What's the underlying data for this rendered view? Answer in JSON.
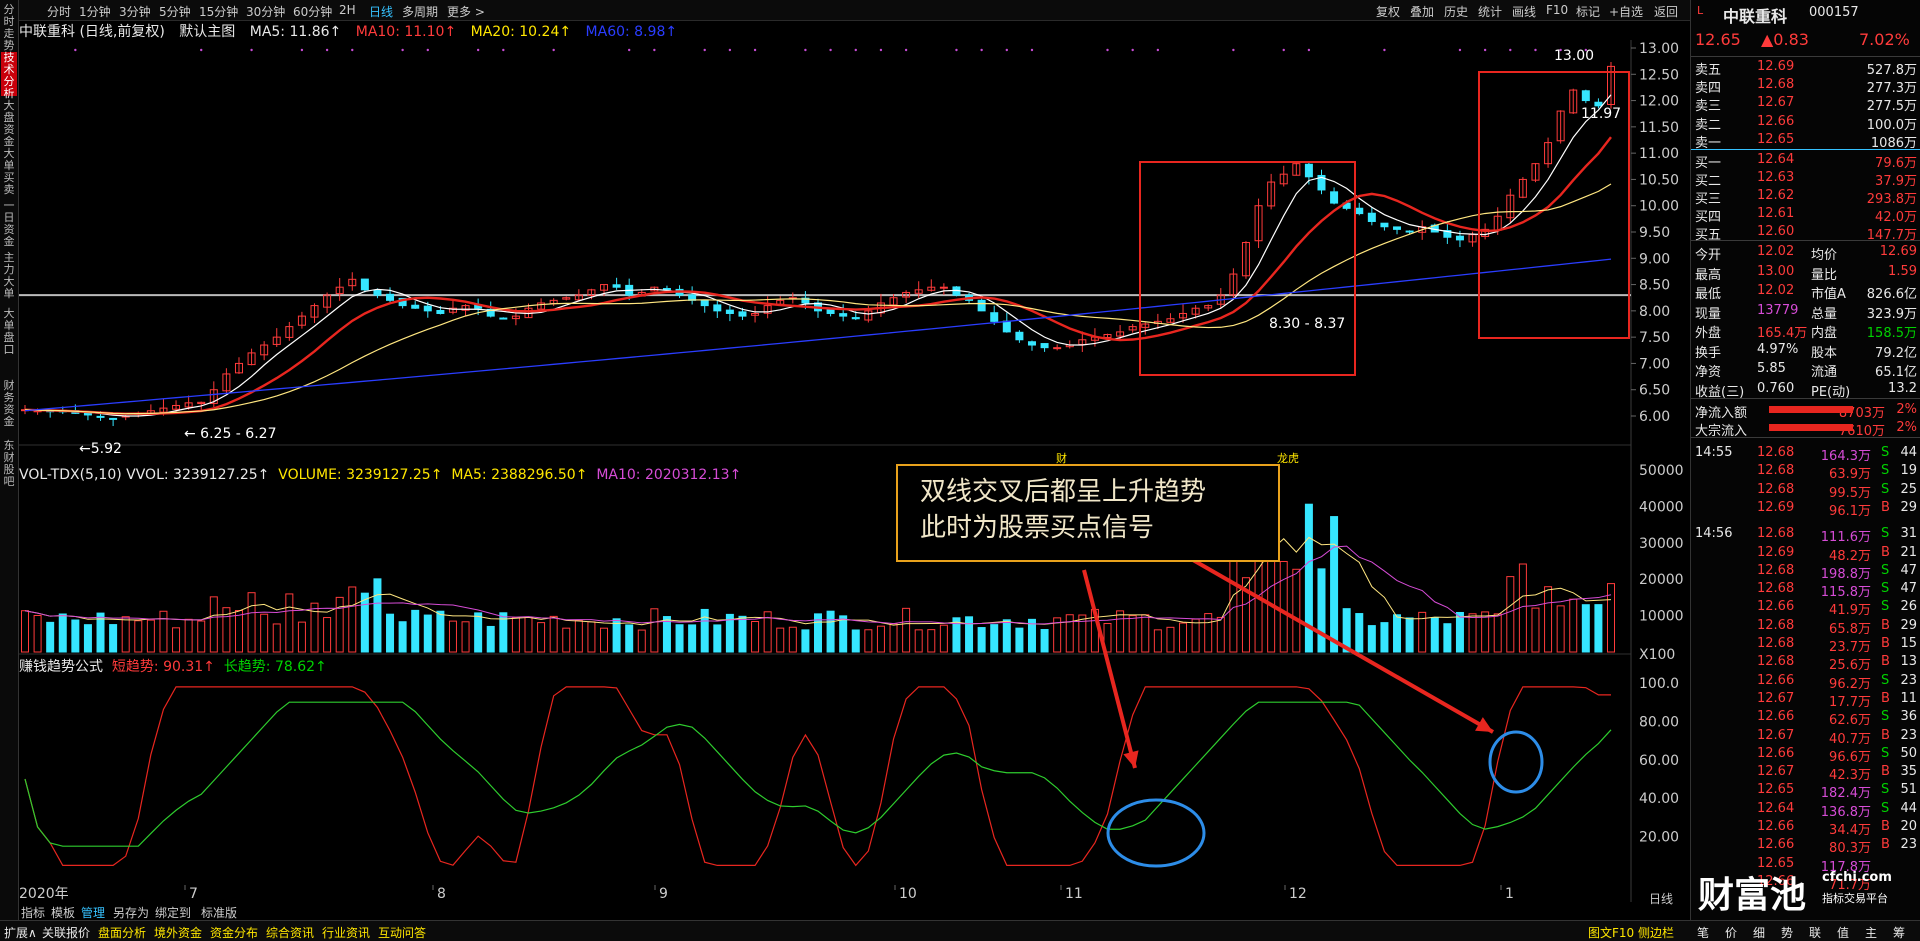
{
  "left_tabs": [
    {
      "label": "分时走势"
    },
    {
      "label": "技术分析"
    },
    {
      "label": "大盘资金"
    },
    {
      "label": "大单买卖"
    },
    {
      "label": "一日资金"
    },
    {
      "label": "主力大单"
    },
    {
      "label": "大单盘口"
    },
    {
      "label": "财务资金"
    },
    {
      "label": "东财股吧"
    }
  ],
  "timeframes": [
    "分时",
    "1分钟",
    "3分钟",
    "5分钟",
    "15分钟",
    "30分钟",
    "60分钟",
    "2H",
    "日线",
    "多周期",
    "更多 >"
  ],
  "toolbar_right": [
    "复权",
    "叠加",
    "历史",
    "统计",
    "画线",
    "F10",
    "标记",
    "+自选",
    "返回"
  ],
  "title": {
    "stock": "中联重科 (日线,前复权)",
    "main": "默认主图",
    "ma5": "MA5: 11.86↑",
    "ma10": "MA10: 11.10↑",
    "ma20": "MA20: 10.24↑",
    "ma60": "MA60: 8.98↑"
  },
  "vol_title": {
    "label": "VOL-TDX(5,10) VVOL: 3239127.25↑",
    "volume": "VOLUME: 3239127.25↑",
    "ma5": "MA5: 2388296.50↑",
    "ma10": "MA10: 2020312.13↑"
  },
  "ind_title": {
    "label": "赚钱趋势公式",
    "short": "短趋势: 90.31↑",
    "long": "长趋势: 78.62↑"
  },
  "price_axis": [
    "13.00",
    "12.50",
    "12.00",
    "11.50",
    "11.00",
    "10.50",
    "10.00",
    "9.50",
    "9.00",
    "8.50",
    "8.00",
    "7.50",
    "7.00",
    "6.50",
    "6.00"
  ],
  "vol_axis": [
    "50000",
    "40000",
    "30000",
    "20000",
    "10000",
    "X100"
  ],
  "ind_axis": [
    "100.0",
    "80.00",
    "60.00",
    "40.00",
    "20.00"
  ],
  "x_labels": [
    "2020年",
    "7",
    "8",
    "9",
    "10",
    "11",
    "12",
    "1"
  ],
  "annotations": {
    "low_label": "5.92",
    "range1": "6.25 - 6.27",
    "range2": "8.30 - 8.37",
    "high_label": "13.00",
    "last_label": "11.97",
    "callout_line1": "双线交叉后都呈上升趋势",
    "callout_line2": "此时为股票买点信号",
    "cai": "财",
    "longhu": "龙虎"
  },
  "chart_data": {
    "type": "candlestick",
    "title": "中联重科 (日线,前复权)",
    "ylim": [
      6.0,
      13.0
    ],
    "x_ticks": [
      "2020年",
      "7",
      "8",
      "9",
      "10",
      "11",
      "12",
      "1"
    ],
    "ohlc_summary": {
      "low": 5.92,
      "high": 13.0,
      "last_close": 12.65
    },
    "ma": {
      "MA5": 11.86,
      "MA10": 11.1,
      "MA20": 10.24,
      "MA60": 8.98
    },
    "volume": {
      "VVOL": 3239127.25,
      "MA5": 2388296.5,
      "MA10": 2020312.13,
      "ylim": [
        0,
        50000
      ]
    },
    "indicator": {
      "short_trend": 90.31,
      "long_trend": 78.62,
      "ylim": [
        0,
        100
      ]
    },
    "closes": [
      6.12,
      6.1,
      6.1,
      6.08,
      6.05,
      6.02,
      5.98,
      5.95,
      6.0,
      6.05,
      6.1,
      6.15,
      6.2,
      6.25,
      6.26,
      6.5,
      6.8,
      7.0,
      7.2,
      7.35,
      7.5,
      7.7,
      7.9,
      8.1,
      8.3,
      8.45,
      8.6,
      8.4,
      8.3,
      8.2,
      8.1,
      8.05,
      8.0,
      7.95,
      8.05,
      8.1,
      8.05,
      7.9,
      7.85,
      7.9,
      8.05,
      8.15,
      8.2,
      8.25,
      8.3,
      8.4,
      8.5,
      8.45,
      8.3,
      8.35,
      8.45,
      8.4,
      8.3,
      8.2,
      8.1,
      8.0,
      7.95,
      7.9,
      7.95,
      8.1,
      8.2,
      8.25,
      8.15,
      8.0,
      7.95,
      7.9,
      7.85,
      8.0,
      8.15,
      8.25,
      8.35,
      8.4,
      8.45,
      8.45,
      8.3,
      8.2,
      8.0,
      7.8,
      7.6,
      7.45,
      7.35,
      7.3,
      7.3,
      7.35,
      7.45,
      7.5,
      7.55,
      7.6,
      7.7,
      7.75,
      7.8,
      7.85,
      7.95,
      8.05,
      8.1,
      8.3,
      8.7,
      9.3,
      10.0,
      10.45,
      10.6,
      10.8,
      10.55,
      10.3,
      10.05,
      9.95,
      9.85,
      9.7,
      9.6,
      9.55,
      9.5,
      9.6,
      9.5,
      9.4,
      9.35,
      9.45,
      9.55,
      9.8,
      10.2,
      10.5,
      10.8,
      11.2,
      11.8,
      12.2,
      12.0,
      11.9,
      12.65
    ]
  },
  "right": {
    "name": "中联重科",
    "code": "000157",
    "price": "12.65",
    "change": "▲0.83",
    "pct": "7.02%",
    "sell": [
      {
        "label": "卖五",
        "price": "12.69",
        "vol": "527.8万"
      },
      {
        "label": "卖四",
        "price": "12.68",
        "vol": "277.3万"
      },
      {
        "label": "卖三",
        "price": "12.67",
        "vol": "277.5万"
      },
      {
        "label": "卖二",
        "price": "12.66",
        "vol": "100.0万"
      },
      {
        "label": "卖一",
        "price": "12.65",
        "vol": "1086万"
      }
    ],
    "buy": [
      {
        "label": "买一",
        "price": "12.64",
        "vol": "79.6万"
      },
      {
        "label": "买二",
        "price": "12.63",
        "vol": "37.9万"
      },
      {
        "label": "买三",
        "price": "12.62",
        "vol": "293.8万"
      },
      {
        "label": "买四",
        "price": "12.61",
        "vol": "42.0万"
      },
      {
        "label": "买五",
        "price": "12.60",
        "vol": "147.7万"
      }
    ],
    "stats": [
      {
        "k1": "今开",
        "v1": "12.02",
        "k2": "均价",
        "v2": "12.69",
        "c1": "red",
        "c2": "red"
      },
      {
        "k1": "最高",
        "v1": "13.00",
        "k2": "量比",
        "v2": "1.59",
        "c1": "red",
        "c2": "red"
      },
      {
        "k1": "最低",
        "v1": "12.02",
        "k2": "市值A",
        "v2": "826.6亿",
        "c1": "red",
        "c2": "wht"
      },
      {
        "k1": "现量",
        "v1": "13779",
        "k2": "总量",
        "v2": "323.9万",
        "c1": "mag",
        "c2": "wht"
      },
      {
        "k1": "外盘",
        "v1": "165.4万",
        "k2": "内盘",
        "v2": "158.5万",
        "c1": "red",
        "c2": "grn"
      },
      {
        "k1": "换手",
        "v1": "4.97%",
        "k2": "股本",
        "v2": "79.2亿",
        "c1": "wht",
        "c2": "wht"
      },
      {
        "k1": "净资",
        "v1": "5.85",
        "k2": "流通",
        "v2": "65.1亿",
        "c1": "wht",
        "c2": "wht"
      },
      {
        "k1": "收益(三)",
        "v1": "0.760",
        "k2": "PE(动)",
        "v2": "13.2",
        "c1": "wht",
        "c2": "wht"
      }
    ],
    "flow": [
      {
        "label": "净流入额",
        "value": "8703万",
        "pct": "2%"
      },
      {
        "label": "大宗流入",
        "value": "7610万",
        "pct": "2%"
      }
    ],
    "ticks": [
      {
        "t": "14:55",
        "p": "12.68",
        "v": "164.3万",
        "s": "S",
        "n": "44",
        "vc": "mag"
      },
      {
        "t": "",
        "p": "12.68",
        "v": "63.9万",
        "s": "S",
        "n": "19",
        "vc": "red"
      },
      {
        "t": "",
        "p": "12.68",
        "v": "99.5万",
        "s": "S",
        "n": "25",
        "vc": "red"
      },
      {
        "t": "",
        "p": "12.69",
        "v": "96.1万",
        "s": "B",
        "n": "29",
        "vc": "red"
      },
      {
        "t": "14:56",
        "p": "12.68",
        "v": "111.6万",
        "s": "S",
        "n": "31",
        "vc": "mag"
      },
      {
        "t": "",
        "p": "12.69",
        "v": "48.2万",
        "s": "B",
        "n": "21",
        "vc": "red"
      },
      {
        "t": "",
        "p": "12.68",
        "v": "198.8万",
        "s": "S",
        "n": "47",
        "vc": "mag"
      },
      {
        "t": "",
        "p": "12.68",
        "v": "115.8万",
        "s": "S",
        "n": "47",
        "vc": "mag"
      },
      {
        "t": "",
        "p": "12.66",
        "v": "41.9万",
        "s": "S",
        "n": "26",
        "vc": "red"
      },
      {
        "t": "",
        "p": "12.68",
        "v": "65.8万",
        "s": "B",
        "n": "29",
        "vc": "red"
      },
      {
        "t": "",
        "p": "12.68",
        "v": "23.7万",
        "s": "B",
        "n": "15",
        "vc": "red"
      },
      {
        "t": "",
        "p": "12.68",
        "v": "25.6万",
        "s": "B",
        "n": "13",
        "vc": "red"
      },
      {
        "t": "",
        "p": "12.66",
        "v": "96.2万",
        "s": "S",
        "n": "23",
        "vc": "red"
      },
      {
        "t": "",
        "p": "12.67",
        "v": "17.7万",
        "s": "B",
        "n": "11",
        "vc": "red"
      },
      {
        "t": "",
        "p": "12.66",
        "v": "62.6万",
        "s": "S",
        "n": "36",
        "vc": "red"
      },
      {
        "t": "",
        "p": "12.67",
        "v": "40.7万",
        "s": "B",
        "n": "23",
        "vc": "red"
      },
      {
        "t": "",
        "p": "12.66",
        "v": "96.6万",
        "s": "S",
        "n": "50",
        "vc": "red"
      },
      {
        "t": "",
        "p": "12.67",
        "v": "42.3万",
        "s": "B",
        "n": "35",
        "vc": "red"
      },
      {
        "t": "",
        "p": "12.65",
        "v": "182.4万",
        "s": "S",
        "n": "51",
        "vc": "mag"
      },
      {
        "t": "",
        "p": "12.64",
        "v": "136.8万",
        "s": "S",
        "n": "44",
        "vc": "mag"
      },
      {
        "t": "",
        "p": "12.66",
        "v": "34.4万",
        "s": "B",
        "n": "20",
        "vc": "red"
      },
      {
        "t": "",
        "p": "12.66",
        "v": "80.3万",
        "s": "B",
        "n": "23",
        "vc": "red"
      },
      {
        "t": "",
        "p": "12.65",
        "v": "117.8万",
        "s": "",
        "n": "",
        "vc": "mag"
      },
      {
        "t": "",
        "p": "12.66",
        "v": "71.7万",
        "s": "",
        "n": "",
        "vc": "red"
      }
    ],
    "bottom_tabs": [
      "笔",
      "价",
      "细",
      "势",
      "联",
      "值",
      "主",
      "筹"
    ]
  },
  "bottom_nav": [
    "指标",
    "模板",
    "管理",
    "另存为",
    "绑定到",
    "标准版"
  ],
  "bottom_links": [
    "扩展∧",
    "关联报价",
    "盘面分析",
    "境外资金",
    "资金分布",
    "综合资讯",
    "行业资讯",
    "互动问答"
  ],
  "bottom_right": "图文F10 侧边栏",
  "day_line": "日线",
  "watermark": {
    "big": "财富池",
    "site": "cfchi.com",
    "sub": "指标交易平台"
  },
  "colors": {
    "up": "#ff3b3b",
    "down": "#36e6ff",
    "ma5": "#ffffff",
    "ma10": "#e8261f",
    "ma20": "#ffe680",
    "ma60": "#2a3dff",
    "short": "#e8261f",
    "long": "#2ecc2e"
  }
}
